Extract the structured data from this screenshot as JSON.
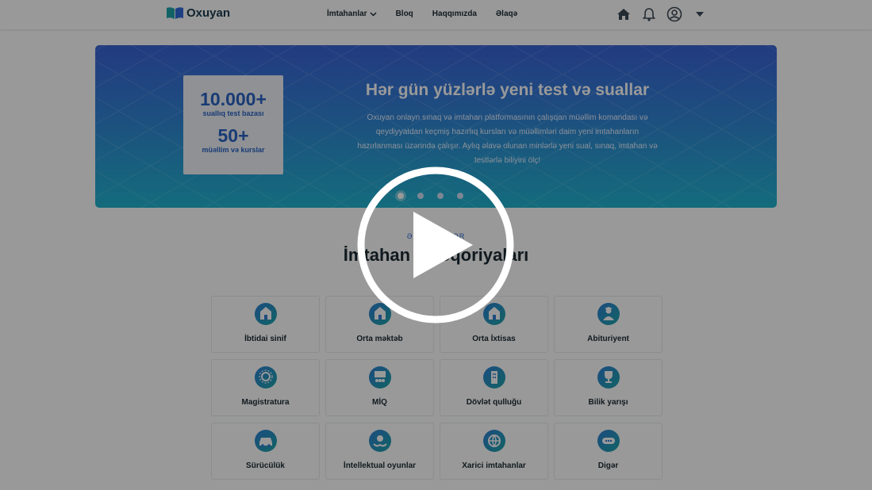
{
  "header": {
    "logo_text": "Oxuyan",
    "logo_icon": "open-book-icon",
    "nav": [
      "İmtahanlar",
      "Bloq",
      "Haqqımızda",
      "Əlaqə"
    ],
    "icons": [
      "home-icon",
      "bell-icon",
      "user-circle-icon",
      "caret-down-icon"
    ]
  },
  "banner": {
    "stat1_value": "10.000+",
    "stat1_label": "suallıq test bazası",
    "stat2_value": "50+",
    "stat2_label": "müəllim və kurslar",
    "title": "Hər gün yüzlərlə yeni test və suallar",
    "desc_lines": [
      "Oxuyan onlayn sınaq və imtahan platformasının çalışqan müəllim komandası və",
      "qeydiyyatdan keçmiş hazırlıq kursları və müəllimləri daim yeni imtahanların",
      "hazırlanması üzərində çalışır. Aylıq əlavə olunan minlərlə yeni sual, sınaq, imtahan və",
      "testlərlə biliyini ölç!"
    ],
    "slides_count": 4,
    "active_slide": 1
  },
  "categories_section": {
    "eyebrow": "ƏN ÇOX … ƏR",
    "title": "İmtahan kateqoriyaları",
    "items": [
      "İbtidai sinif",
      "Orta məktəb",
      "Orta İxtisas",
      "Abituriyent",
      "Magistratura",
      "MİQ",
      "Dövlət qulluğu",
      "Bilik yarışı",
      "Sürücülük",
      "İntellektual oyunlar",
      "Xarici imtahanlar",
      "Digər"
    ],
    "item_icons": [
      "school-building-icon",
      "school-building-icon",
      "school-building-icon",
      "graduate-icon",
      "award-badge-icon",
      "teacher-board-icon",
      "government-building-icon",
      "trophy-icon",
      "car-icon",
      "brain-hands-icon",
      "globe-icon",
      "more-dots-icon"
    ]
  },
  "video": {
    "play_icon": "play-icon"
  },
  "colors": {
    "accent": "#2f6bd9",
    "icon_gradient_start": "#2f7fd6",
    "icon_gradient_end": "#1ea5a8"
  }
}
